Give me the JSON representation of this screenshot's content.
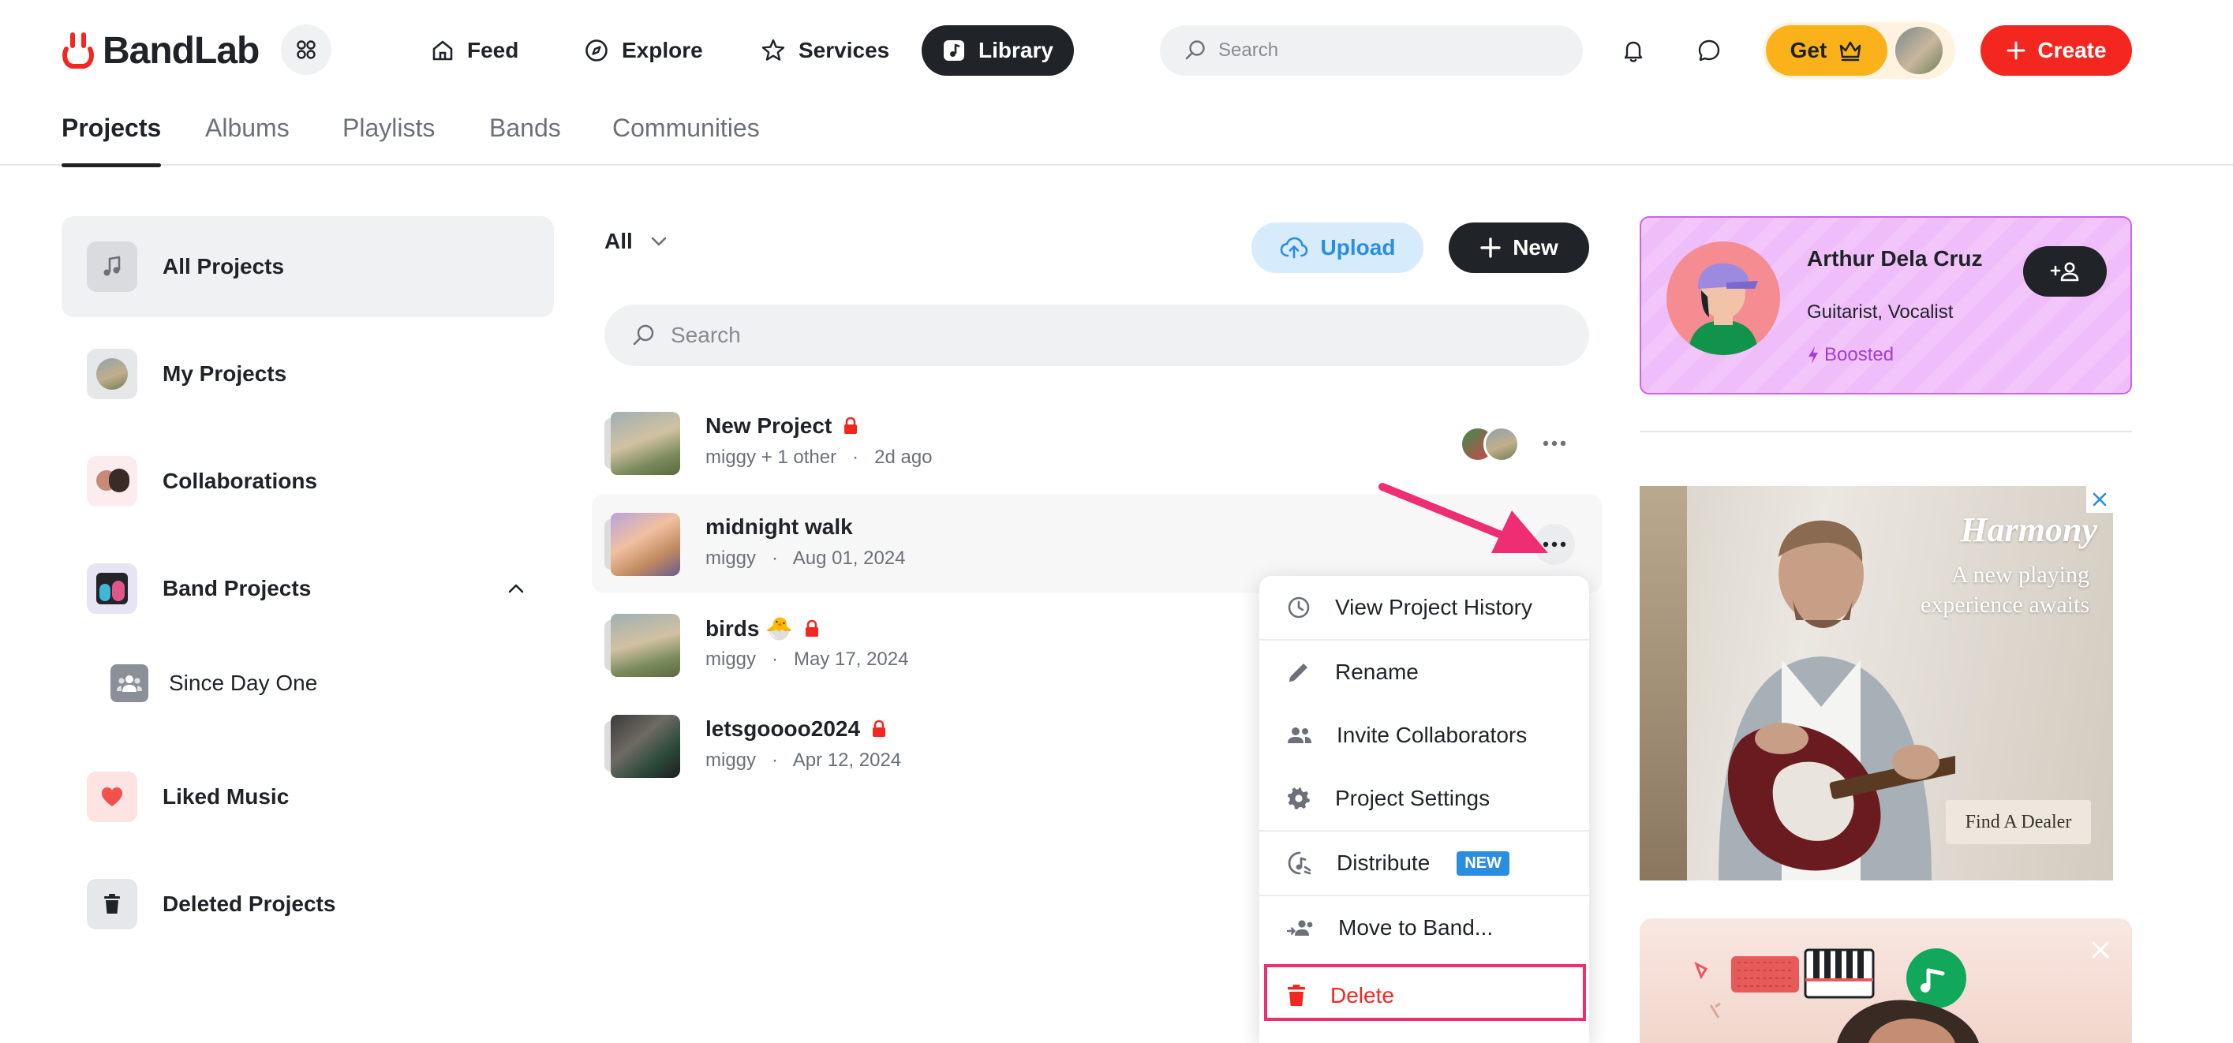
{
  "app": {
    "logo_text": "BandLab"
  },
  "nav": {
    "items": [
      {
        "label": "Feed",
        "icon": "home-icon"
      },
      {
        "label": "Explore",
        "icon": "compass-icon"
      },
      {
        "label": "Services",
        "icon": "star-icon"
      },
      {
        "label": "Library",
        "icon": "library-icon",
        "active": true
      }
    ],
    "search_placeholder": "Search",
    "get_label": "Get",
    "create_label": "Create"
  },
  "subtabs": [
    {
      "label": "Projects",
      "active": true
    },
    {
      "label": "Albums"
    },
    {
      "label": "Playlists"
    },
    {
      "label": "Bands"
    },
    {
      "label": "Communities"
    }
  ],
  "sidebar": {
    "items": [
      {
        "label": "All Projects",
        "icon": "music-note-icon",
        "active": true
      },
      {
        "label": "My Projects",
        "icon": "avatar-image"
      },
      {
        "label": "Collaborations",
        "icon": "collaborators-image"
      },
      {
        "label": "Band Projects",
        "icon": "band-image",
        "expanded": true
      },
      {
        "label": "Liked Music",
        "icon": "heart-icon"
      },
      {
        "label": "Deleted Projects",
        "icon": "trash-icon"
      }
    ],
    "band_sub_item": {
      "label": "Since Day One",
      "icon": "group-icon"
    }
  },
  "projects": {
    "filter_label": "All",
    "upload_label": "Upload",
    "new_label": "New",
    "search_placeholder": "Search",
    "rows": [
      {
        "title": "New Project",
        "private": true,
        "author": "miggy + 1 other",
        "date": "2d ago",
        "has_collaborators": true
      },
      {
        "title": "midnight walk",
        "private": false,
        "author": "miggy",
        "date": "Aug 01, 2024",
        "hovered": true
      },
      {
        "title": "birds 🐣",
        "private": true,
        "author": "miggy",
        "date": "May 17, 2024"
      },
      {
        "title": "letsgoooo2024",
        "private": true,
        "author": "miggy",
        "date": "Apr 12, 2024"
      }
    ]
  },
  "context_menu": {
    "items": [
      {
        "label": "View Project History",
        "icon": "clock-icon"
      },
      {
        "label": "Rename",
        "icon": "pencil-icon"
      },
      {
        "label": "Invite Collaborators",
        "icon": "people-icon"
      },
      {
        "label": "Project Settings",
        "icon": "gear-icon"
      },
      {
        "label": "Distribute",
        "icon": "distribute-icon",
        "badge": "NEW"
      },
      {
        "label": "Move to Band...",
        "icon": "move-group-icon"
      },
      {
        "label": "Delete",
        "icon": "trash-icon",
        "danger": true,
        "highlighted": true
      }
    ]
  },
  "profile_card": {
    "name": "Arthur Dela Cruz",
    "role": "Guitarist, Vocalist",
    "status": "Boosted"
  },
  "ads": {
    "ad1": {
      "brand": "Harmony",
      "tagline": "A new playing experience awaits",
      "cta": "Find A Dealer"
    }
  },
  "colors": {
    "brand_red": "#f3271f",
    "dark": "#202327",
    "get_yellow": "#fbb21a",
    "upload_blue_bg": "#d6ebfb",
    "upload_blue_text": "#2a8ee0",
    "highlight_pink": "#ef2d72",
    "boost_purple": "#a23ed6"
  }
}
